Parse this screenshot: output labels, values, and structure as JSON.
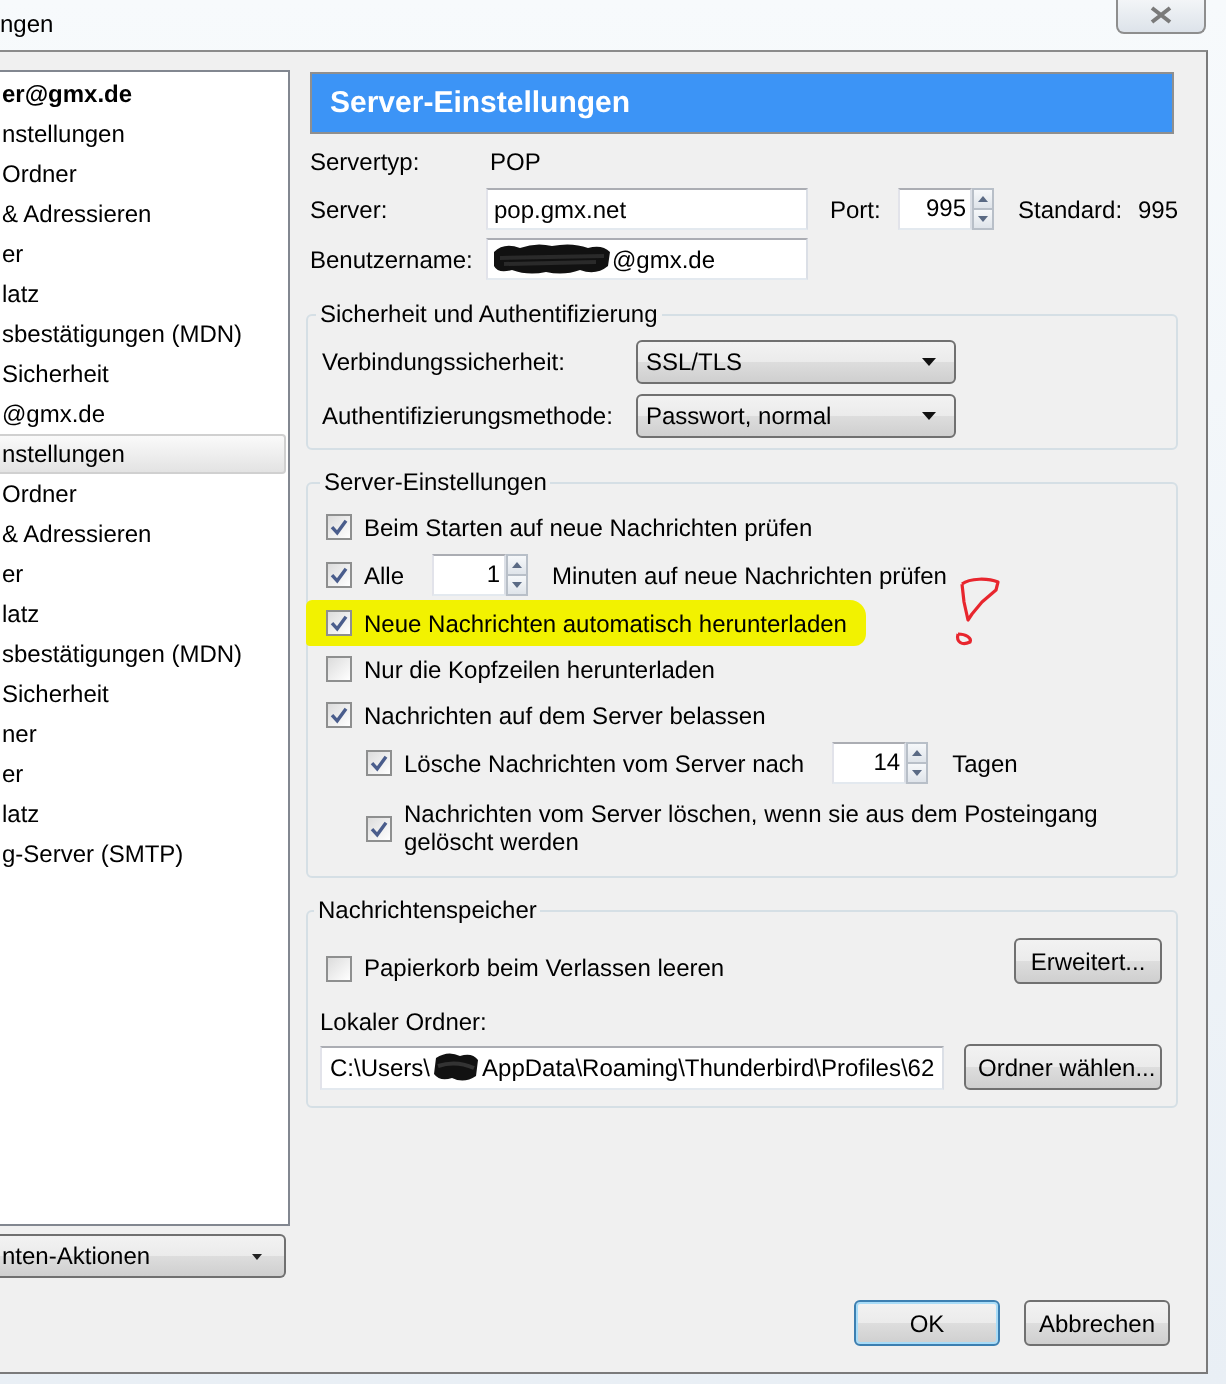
{
  "window": {
    "title": "ngen"
  },
  "sidebar": {
    "items": [
      {
        "label": "er@gmx.de",
        "bold": true,
        "selected": false
      },
      {
        "label": "nstellungen",
        "bold": false,
        "selected": false
      },
      {
        "label": "Ordner",
        "bold": false,
        "selected": false
      },
      {
        "label": "& Adressieren",
        "bold": false,
        "selected": false
      },
      {
        "label": "er",
        "bold": false,
        "selected": false
      },
      {
        "label": "latz",
        "bold": false,
        "selected": false
      },
      {
        "label": "sbestätigungen (MDN)",
        "bold": false,
        "selected": false
      },
      {
        "label": "Sicherheit",
        "bold": false,
        "selected": false
      },
      {
        "label": "@gmx.de",
        "bold": false,
        "selected": false
      },
      {
        "label": "nstellungen",
        "bold": false,
        "selected": true
      },
      {
        "label": "Ordner",
        "bold": false,
        "selected": false
      },
      {
        "label": "& Adressieren",
        "bold": false,
        "selected": false
      },
      {
        "label": "er",
        "bold": false,
        "selected": false
      },
      {
        "label": "latz",
        "bold": false,
        "selected": false
      },
      {
        "label": "sbestätigungen (MDN)",
        "bold": false,
        "selected": false
      },
      {
        "label": "Sicherheit",
        "bold": false,
        "selected": false
      },
      {
        "label": "ner",
        "bold": false,
        "selected": false
      },
      {
        "label": "er",
        "bold": false,
        "selected": false
      },
      {
        "label": "latz",
        "bold": false,
        "selected": false
      },
      {
        "label": "g-Server (SMTP)",
        "bold": false,
        "selected": false
      }
    ],
    "actions_button": "nten-Aktionen"
  },
  "panel": {
    "title": "Server-Einstellungen",
    "server_type": {
      "label": "Servertyp:",
      "value": "POP"
    },
    "server": {
      "label": "Server:",
      "value": "pop.gmx.net"
    },
    "port": {
      "label": "Port:",
      "value": "995",
      "default_label": "Standard:",
      "default_value": "995"
    },
    "username": {
      "label": "Benutzername:",
      "value": "@gmx.de"
    }
  },
  "security": {
    "title": "Sicherheit und Authentifizierung",
    "fields": [
      {
        "label": "Verbindungssicherheit:",
        "value": "SSL/TLS"
      },
      {
        "label": "Authentifizierungsmethode:",
        "value": "Passwort, normal"
      }
    ]
  },
  "server_settings": {
    "title": "Server-Einstellungen",
    "options": [
      {
        "kind": "check",
        "label": "Beim Starten auf neue Nachrichten prüfen",
        "checked": true,
        "highlighted": false
      },
      {
        "kind": "interval",
        "label": "Alle",
        "checked": true,
        "value": "1",
        "unit": "Minuten auf neue Nachrichten prüfen",
        "highlighted": false
      },
      {
        "kind": "check",
        "label": "Neue Nachrichten automatisch herunterladen",
        "checked": true,
        "highlighted": true
      },
      {
        "kind": "check",
        "label": "Nur die Kopfzeilen herunterladen",
        "checked": false,
        "highlighted": false
      },
      {
        "kind": "check",
        "label": "Nachrichten auf dem Server belassen",
        "checked": true,
        "highlighted": false,
        "children": [
          {
            "kind": "interval",
            "label": "Lösche Nachrichten vom Server nach",
            "checked": true,
            "value": "14",
            "unit": "Tagen",
            "highlighted": false
          },
          {
            "kind": "check",
            "label": "Nachrichten vom Server löschen, wenn sie aus dem Posteingang gelöscht werden",
            "checked": true,
            "highlighted": false
          }
        ]
      }
    ]
  },
  "storage": {
    "title": "Nachrichtenspeicher",
    "empty_trash": {
      "label": "Papierkorb beim Verlassen leeren",
      "checked": false
    },
    "advanced_button": "Erweitert...",
    "local_folder_label": "Lokaler Ordner:",
    "local_folder_path": [
      "C:\\Users\\",
      "AppData\\Roaming\\Thunderbird\\Profiles\\62"
    ],
    "choose_button": "Ordner wählen..."
  },
  "buttons": [
    {
      "label": "OK",
      "default": true
    },
    {
      "label": "Abbrechen",
      "default": false
    }
  ]
}
